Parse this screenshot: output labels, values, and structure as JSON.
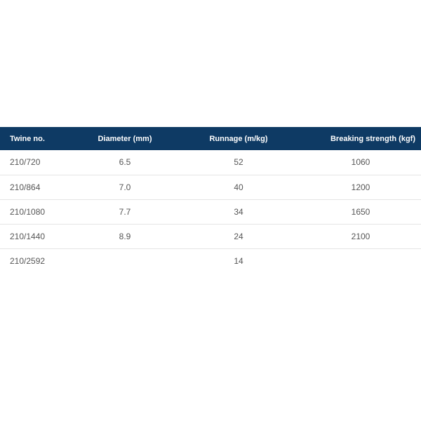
{
  "table": {
    "headers": {
      "twine": "Twine no.",
      "diameter": "Diameter (mm)",
      "runnage": "Runnage (m/kg)",
      "breaking": "Breaking strength (kgf)"
    },
    "rows": [
      {
        "twine": "210/720",
        "diameter": "6.5",
        "runnage": "52",
        "breaking": "1060"
      },
      {
        "twine": "210/864",
        "diameter": "7.0",
        "runnage": "40",
        "breaking": "1200"
      },
      {
        "twine": "210/1080",
        "diameter": "7.7",
        "runnage": "34",
        "breaking": "1650"
      },
      {
        "twine": "210/1440",
        "diameter": "8.9",
        "runnage": "24",
        "breaking": "2100"
      },
      {
        "twine": "210/2592",
        "diameter": "",
        "runnage": "14",
        "breaking": ""
      }
    ]
  },
  "colors": {
    "header_background": "#0e3a64",
    "header_text": "#ffffff",
    "cell_text": "#555555",
    "row_divider": "#e4e4e4"
  }
}
